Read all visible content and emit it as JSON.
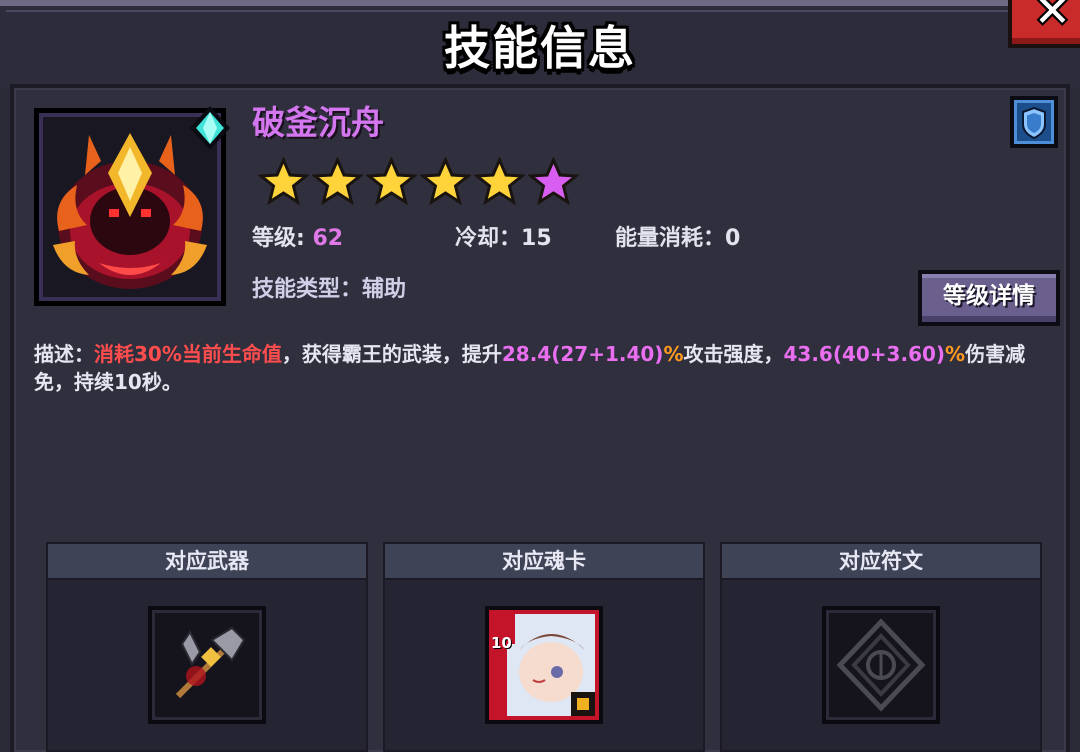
{
  "dialog": {
    "title": "技能信息",
    "close_icon": "close-icon"
  },
  "skill": {
    "name": "破釜沉舟",
    "icon": "demon-crown-icon",
    "rarity_icon": "diamond-gem-icon",
    "stars": {
      "gold": 5,
      "purple": 1
    },
    "level_label": "等级: ",
    "level_value": "62",
    "cooldown_label": "冷却：",
    "cooldown_value": "15",
    "energy_label": "能量消耗：",
    "energy_value": "0",
    "type_label": "技能类型：",
    "type_value": "辅助",
    "detail_button": "等级详情",
    "shield_icon": "shield-icon"
  },
  "description": {
    "prefix": "描述：",
    "cost": "消耗30%当前生命值",
    "text1": "，获得霸王的武装，提升",
    "attack_value": "28.4(27+1.40)",
    "attack_pct": "%",
    "text2": "攻击强度，",
    "reduce_value": "43.6(40+3.60)",
    "reduce_pct": "%",
    "text3": "伤害减免，持续10秒。"
  },
  "slots": {
    "weapon": {
      "title": "对应武器",
      "icon": "axe-icon"
    },
    "card": {
      "title": "对应魂卡",
      "icon": "soul-card-icon",
      "badge": "10"
    },
    "rune": {
      "title": "对应符文",
      "icon": "rune-icon"
    }
  },
  "colors": {
    "skill_name": "#d476ef",
    "highlight_red": "#ff4d4d",
    "highlight_pink": "#ea6ff0",
    "highlight_orange": "#ff9a1f",
    "close_button": "#c92a2a"
  }
}
